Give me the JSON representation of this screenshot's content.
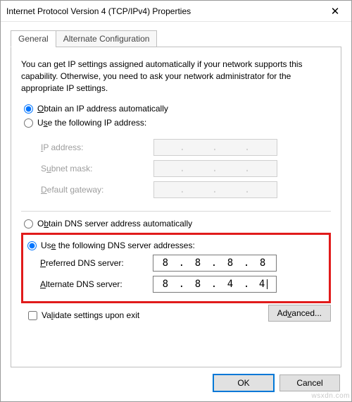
{
  "window": {
    "title": "Internet Protocol Version 4 (TCP/IPv4) Properties",
    "close_glyph": "✕"
  },
  "tabs": {
    "general": "General",
    "alternate": "Alternate Configuration"
  },
  "intro": "You can get IP settings assigned automatically if your network supports this capability. Otherwise, you need to ask your network administrator for the appropriate IP settings.",
  "ip": {
    "auto_label_pre": "O",
    "auto_label_post": "btain an IP address automatically",
    "manual_label_pre": "U",
    "manual_label_post": "se the following IP address:",
    "addr_label_pre": "I",
    "addr_label_post": "P address:",
    "mask_label_pre": "S",
    "mask_label_post": "ubnet mask:",
    "gw_label_pre": "D",
    "gw_label_post": "efault gateway:"
  },
  "dns": {
    "auto_label_pre": "O",
    "auto_label_post": "btain DNS server address automatically",
    "manual_label_pre": "Us",
    "manual_label_key": "e",
    "manual_label_post": " the following DNS server addresses:",
    "pref_label_pre": "P",
    "pref_label_post": "referred DNS server:",
    "alt_label_pre": "A",
    "alt_label_post": "lternate DNS server:",
    "preferred": {
      "o1": "8",
      "o2": "8",
      "o3": "8",
      "o4": "8"
    },
    "alternate": {
      "o1": "8",
      "o2": "8",
      "o3": "4",
      "o4": "4"
    }
  },
  "validate_label_pre": "V",
  "validate_label_post": "alidate settings upon exit",
  "advanced_label": "Advanced...",
  "ok_label": "OK",
  "cancel_label": "Cancel",
  "watermark": "wsxdn.com"
}
